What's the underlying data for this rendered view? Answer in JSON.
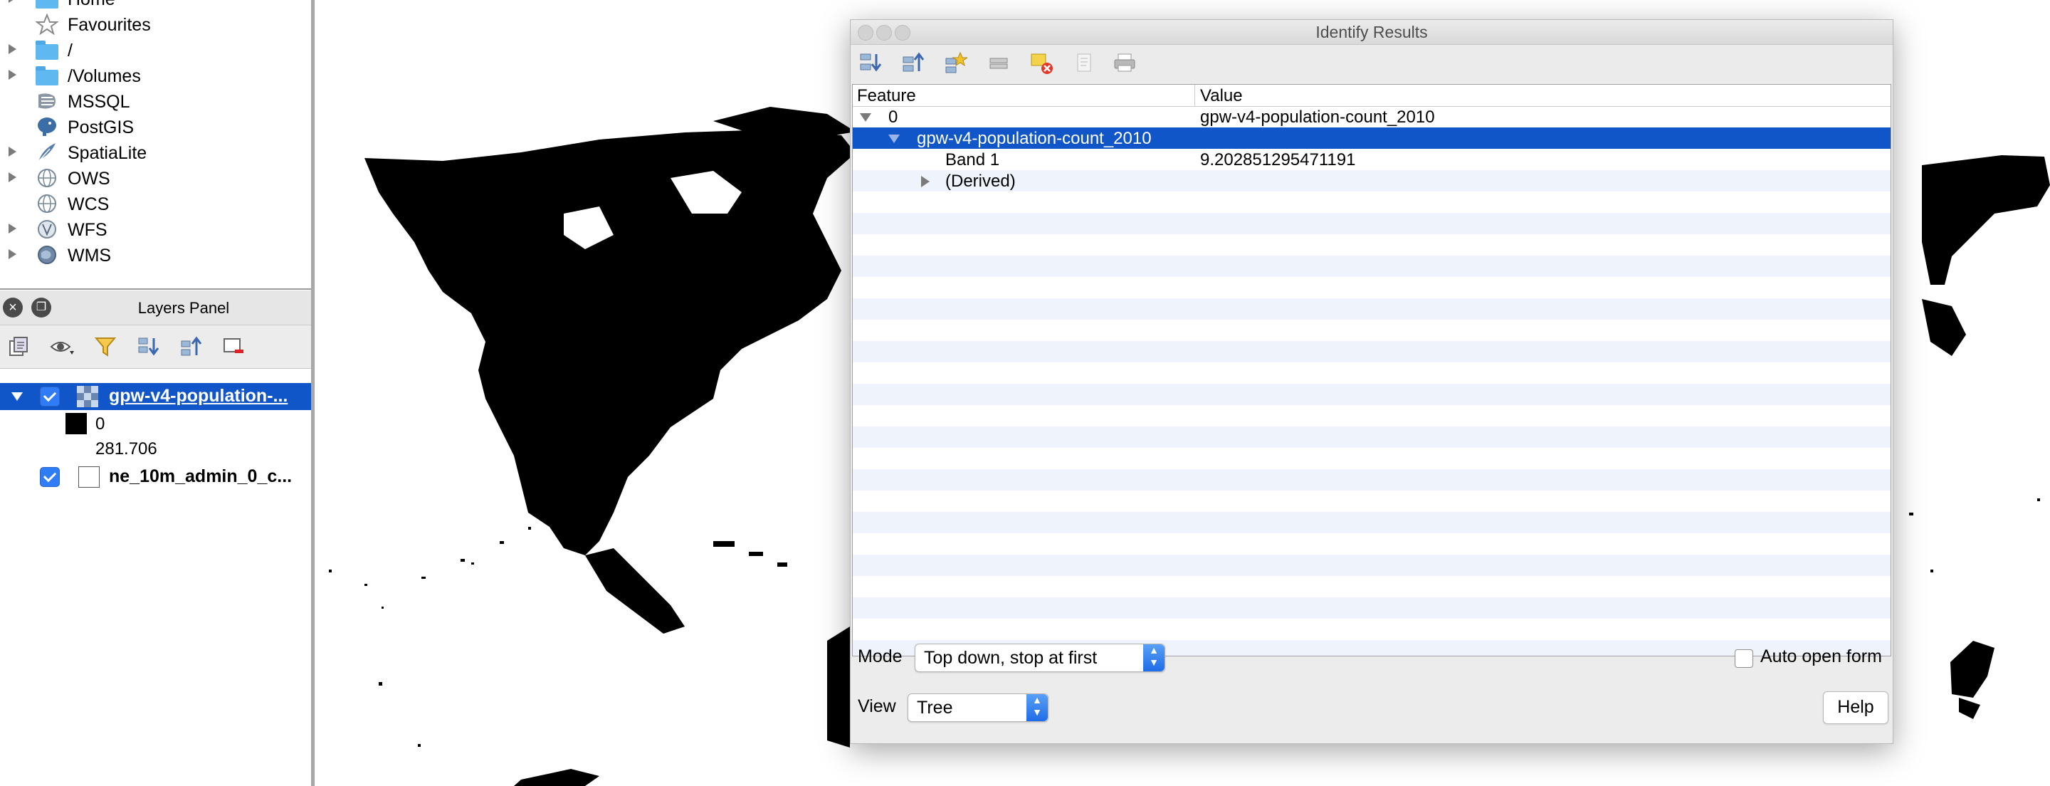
{
  "browser": {
    "items": [
      {
        "label": "Home",
        "arrow": true,
        "icon": "folder-icon"
      },
      {
        "label": "Favourites",
        "arrow": false,
        "icon": "star-icon"
      },
      {
        "label": "/",
        "arrow": true,
        "icon": "folder-icon"
      },
      {
        "label": "/Volumes",
        "arrow": true,
        "icon": "folder-icon"
      },
      {
        "label": "MSSQL",
        "arrow": false,
        "icon": "mssql-icon"
      },
      {
        "label": "PostGIS",
        "arrow": false,
        "icon": "postgis-elephant-icon"
      },
      {
        "label": "SpatiaLite",
        "arrow": true,
        "icon": "spatialite-feather-icon"
      },
      {
        "label": "OWS",
        "arrow": true,
        "icon": "globe-icon"
      },
      {
        "label": "WCS",
        "arrow": false,
        "icon": "globe-icon"
      },
      {
        "label": "WFS",
        "arrow": true,
        "icon": "wfs-globe-icon"
      },
      {
        "label": "WMS",
        "arrow": true,
        "icon": "wms-globe-icon"
      }
    ]
  },
  "layers_panel": {
    "title": "Layers Panel",
    "layers": [
      {
        "name": "gpw-v4-population-...",
        "checked": true,
        "selected": true
      },
      {
        "name": "ne_10m_admin_0_c...",
        "checked": true,
        "selected": false
      }
    ],
    "legend": {
      "min_label": "0",
      "max_label": "281.706",
      "min_color": "#000000"
    }
  },
  "identify": {
    "title": "Identify Results",
    "columns": {
      "feature": "Feature",
      "value": "Value"
    },
    "rows": {
      "r0_feature": "0",
      "r0_value": "gpw-v4-population-count_2010",
      "r1_feature": "gpw-v4-population-count_2010",
      "r2_feature": "Band 1",
      "r2_value": "9.202851295471191",
      "r3_feature": "(Derived)"
    },
    "mode_label": "Mode",
    "mode_value": "Top down, stop at first",
    "view_label": "View",
    "view_value": "Tree",
    "auto_open_label": "Auto open form",
    "auto_open_checked": false,
    "help_label": "Help"
  },
  "colors": {
    "selection": "#1156c9",
    "row_stripe": "#eef3fc",
    "map_land": "#000000",
    "map_background": "#ffffff"
  }
}
